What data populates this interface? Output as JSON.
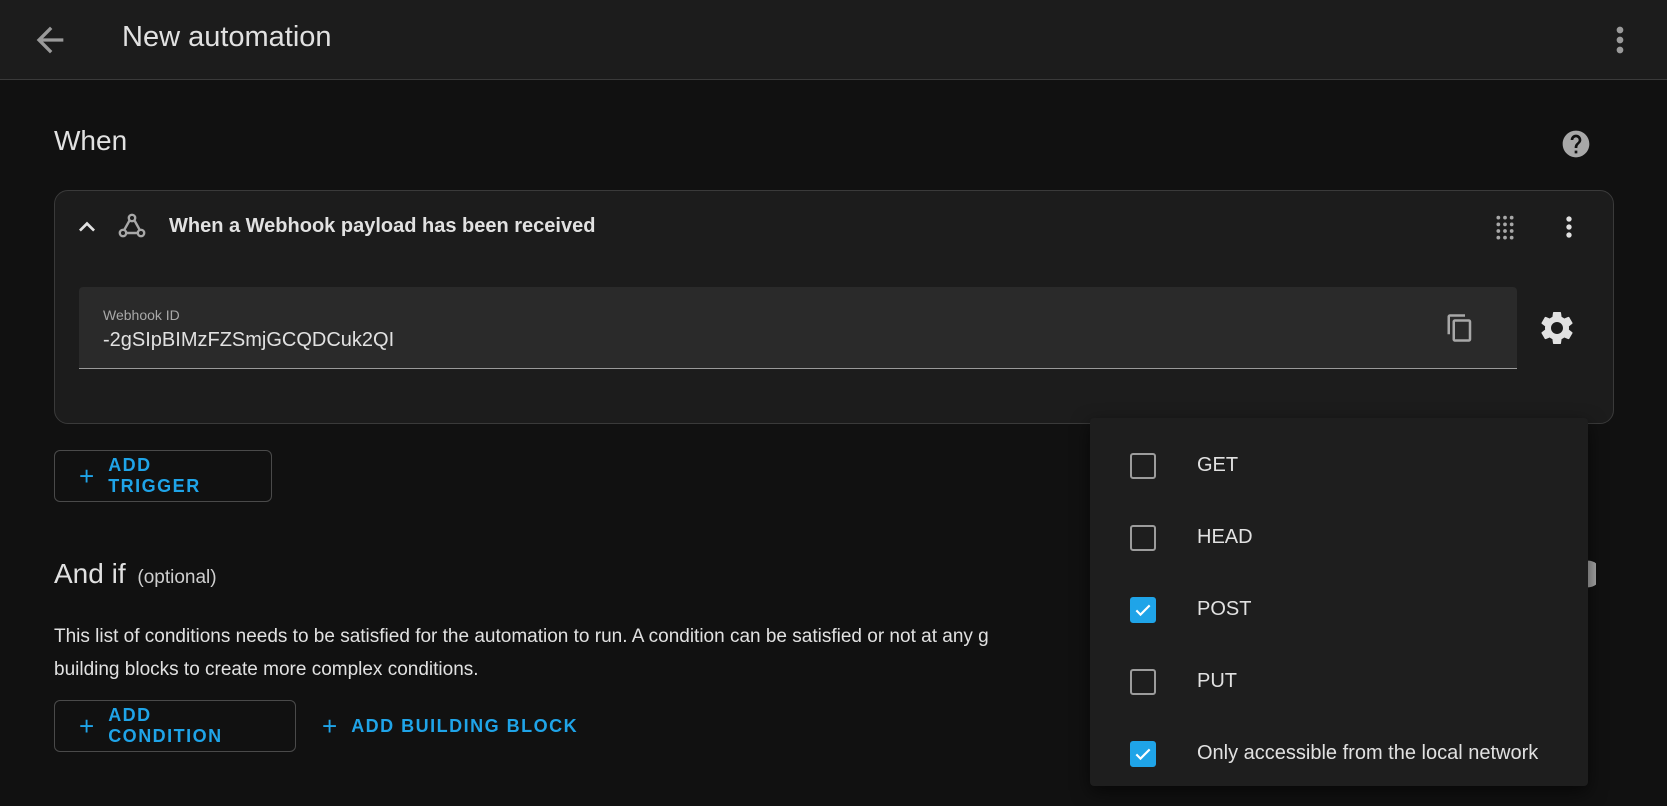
{
  "header": {
    "title": "New automation"
  },
  "when": {
    "title": "When",
    "trigger": {
      "title": "When a Webhook payload has been received",
      "field_label": "Webhook ID",
      "field_value": "-2gSIpBIMzFZSmjGCQDCuk2QI"
    },
    "add_trigger_label": "ADD TRIGGER"
  },
  "and_if": {
    "title": "And if",
    "optional": "(optional)",
    "description": "This list of conditions needs to be satisfied for the automation to run. A condition can be satisfied or not at any g",
    "description_line2": "building blocks to create more complex conditions.",
    "add_condition_label": "ADD CONDITION",
    "add_building_block_label": "ADD BUILDING BLOCK"
  },
  "methods_menu": {
    "options": [
      {
        "label": "GET",
        "checked": false
      },
      {
        "label": "HEAD",
        "checked": false
      },
      {
        "label": "POST",
        "checked": true
      },
      {
        "label": "PUT",
        "checked": false
      },
      {
        "label": "Only accessible from the local network",
        "checked": true
      }
    ]
  },
  "colors": {
    "accent": "#1fa4e8",
    "background": "#111111",
    "card": "#1c1c1c"
  },
  "icons": [
    "arrow-left-icon",
    "dots-vertical-icon",
    "help-circle-icon",
    "chevron-up-icon",
    "webhook-icon",
    "drag-handle-icon",
    "copy-icon",
    "gear-icon",
    "plus-icon",
    "check-icon"
  ]
}
